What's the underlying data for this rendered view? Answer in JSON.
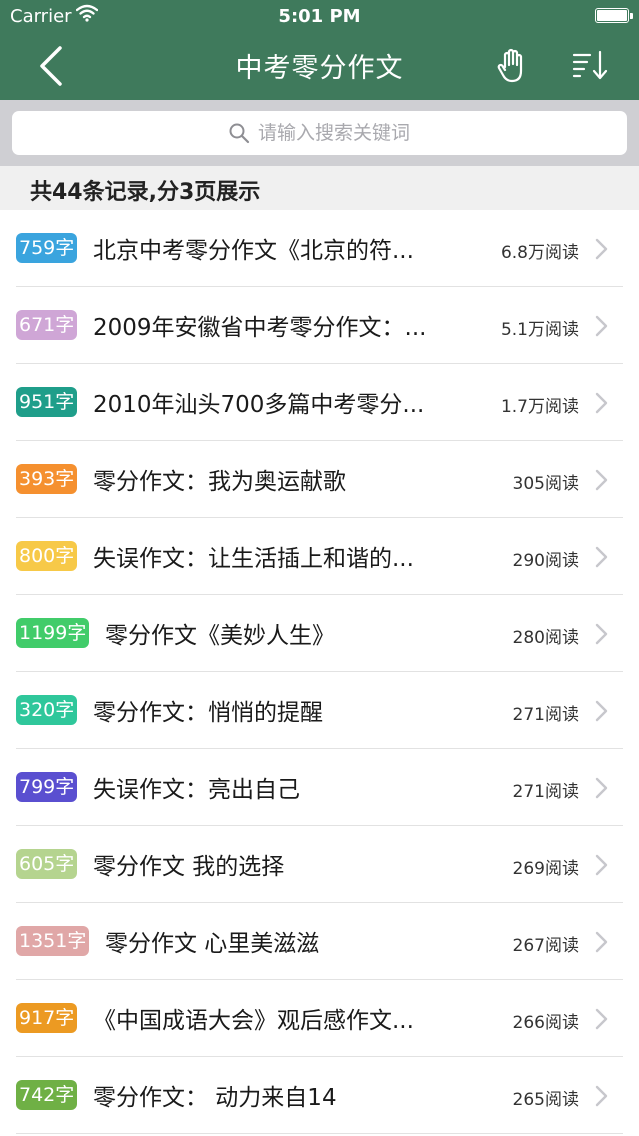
{
  "status_bar": {
    "carrier": "Carrier",
    "time": "5:01 PM"
  },
  "nav": {
    "title": "中考零分作文"
  },
  "search": {
    "placeholder": "请输入搜索关键词",
    "value": ""
  },
  "summary": {
    "text": "共44条记录,分3页展示"
  },
  "items": [
    {
      "badge": "759字",
      "badge_color": "#3aa4de",
      "title": "北京中考零分作文《北京的符...",
      "reads": "6.8万阅读"
    },
    {
      "badge": "671字",
      "badge_color": "#cfa6d6",
      "title": "2009年安徽省中考零分作文：...",
      "reads": "5.1万阅读"
    },
    {
      "badge": "951字",
      "badge_color": "#1f9e8a",
      "title": "2010年汕头700多篇中考零分...",
      "reads": "1.7万阅读"
    },
    {
      "badge": "393字",
      "badge_color": "#f5902f",
      "title": "零分作文：我为奥运献歌",
      "reads": "305阅读"
    },
    {
      "badge": "800字",
      "badge_color": "#f7c948",
      "title": "失误作文：让生活插上和谐的...",
      "reads": "290阅读"
    },
    {
      "badge": "1199字",
      "badge_color": "#41cc6a",
      "title": "零分作文《美妙人生》",
      "reads": "280阅读"
    },
    {
      "badge": "320字",
      "badge_color": "#2fc79b",
      "title": "零分作文：悄悄的提醒",
      "reads": "271阅读"
    },
    {
      "badge": "799字",
      "badge_color": "#5a4fd0",
      "title": "失误作文：亮出自己",
      "reads": "271阅读"
    },
    {
      "badge": "605字",
      "badge_color": "#b5d48f",
      "title": "零分作文 我的选择",
      "reads": "269阅读"
    },
    {
      "badge": "1351字",
      "badge_color": "#e0a7a7",
      "title": "零分作文 心里美滋滋",
      "reads": "267阅读"
    },
    {
      "badge": "917字",
      "badge_color": "#ec9a22",
      "title": "《中国成语大会》观后感作文...",
      "reads": "266阅读"
    },
    {
      "badge": "742字",
      "badge_color": "#6fb045",
      "title": "零分作文：  动力来自14",
      "reads": "265阅读"
    }
  ]
}
